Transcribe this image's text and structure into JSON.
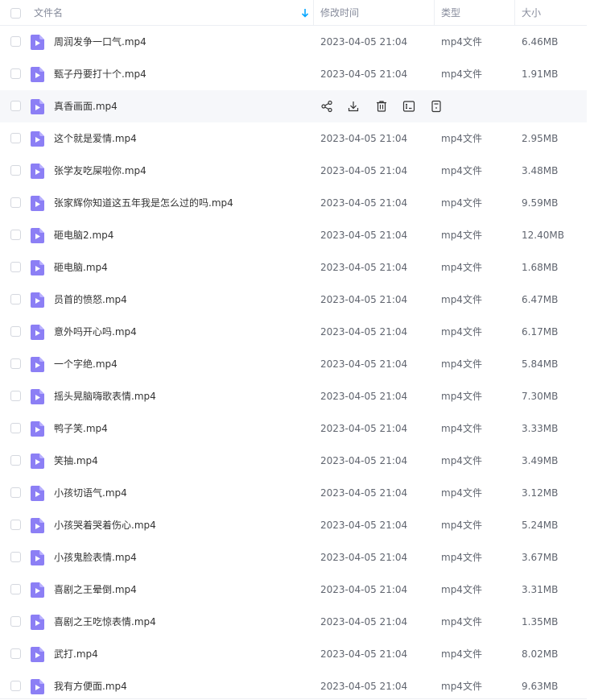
{
  "header": {
    "name_label": "文件名",
    "time_label": "修改时间",
    "type_label": "类型",
    "size_label": "大小"
  },
  "hover_row_actions": [
    "share-icon",
    "download-icon",
    "delete-icon",
    "rename-icon",
    "more-icon"
  ],
  "colors": {
    "accent": "#06a7ff",
    "file_icon": "#8c7ff5",
    "hover_bg": "#f6f7fa"
  },
  "files": [
    {
      "name": "周润发争一口气.mp4",
      "time": "2023-04-05 21:04",
      "type": "mp4文件",
      "size": "6.46MB"
    },
    {
      "name": "甄子丹要打十个.mp4",
      "time": "2023-04-05 21:04",
      "type": "mp4文件",
      "size": "1.91MB"
    },
    {
      "name": "真香画面.mp4",
      "time": "",
      "type": "",
      "size": ""
    },
    {
      "name": "这个就是爱情.mp4",
      "time": "2023-04-05 21:04",
      "type": "mp4文件",
      "size": "2.95MB"
    },
    {
      "name": "张学友吃屎啦你.mp4",
      "time": "2023-04-05 21:04",
      "type": "mp4文件",
      "size": "3.48MB"
    },
    {
      "name": "张家辉你知道这五年我是怎么过的吗.mp4",
      "time": "2023-04-05 21:04",
      "type": "mp4文件",
      "size": "9.59MB"
    },
    {
      "name": "砸电脑2.mp4",
      "time": "2023-04-05 21:04",
      "type": "mp4文件",
      "size": "12.40MB"
    },
    {
      "name": "砸电脑.mp4",
      "time": "2023-04-05 21:04",
      "type": "mp4文件",
      "size": "1.68MB"
    },
    {
      "name": "员首的愤怒.mp4",
      "time": "2023-04-05 21:04",
      "type": "mp4文件",
      "size": "6.47MB"
    },
    {
      "name": "意外吗开心吗.mp4",
      "time": "2023-04-05 21:04",
      "type": "mp4文件",
      "size": "6.17MB"
    },
    {
      "name": "一个字绝.mp4",
      "time": "2023-04-05 21:04",
      "type": "mp4文件",
      "size": "5.84MB"
    },
    {
      "name": "摇头晃脑嗨歌表情.mp4",
      "time": "2023-04-05 21:04",
      "type": "mp4文件",
      "size": "7.30MB"
    },
    {
      "name": "鸭子笑.mp4",
      "time": "2023-04-05 21:04",
      "type": "mp4文件",
      "size": "3.33MB"
    },
    {
      "name": "笑抽.mp4",
      "time": "2023-04-05 21:04",
      "type": "mp4文件",
      "size": "3.49MB"
    },
    {
      "name": "小孩切语气.mp4",
      "time": "2023-04-05 21:04",
      "type": "mp4文件",
      "size": "3.12MB"
    },
    {
      "name": "小孩哭着哭着伤心.mp4",
      "time": "2023-04-05 21:04",
      "type": "mp4文件",
      "size": "5.24MB"
    },
    {
      "name": "小孩鬼脸表情.mp4",
      "time": "2023-04-05 21:04",
      "type": "mp4文件",
      "size": "3.67MB"
    },
    {
      "name": "喜剧之王晕倒.mp4",
      "time": "2023-04-05 21:04",
      "type": "mp4文件",
      "size": "3.31MB"
    },
    {
      "name": "喜剧之王吃惊表情.mp4",
      "time": "2023-04-05 21:04",
      "type": "mp4文件",
      "size": "1.35MB"
    },
    {
      "name": "武打.mp4",
      "time": "2023-04-05 21:04",
      "type": "mp4文件",
      "size": "8.02MB"
    },
    {
      "name": "我有方便面.mp4",
      "time": "2023-04-05 21:04",
      "type": "mp4文件",
      "size": "9.63MB"
    }
  ]
}
